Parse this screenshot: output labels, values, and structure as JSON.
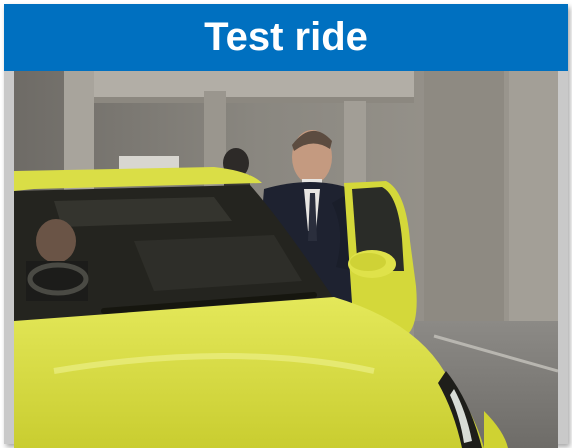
{
  "slide": {
    "title": "Test ride",
    "title_bar_color": "#0070c0",
    "frame_color": "#c9c9c9"
  },
  "photo": {
    "subject": "person-leaning-into-yellow-car",
    "car_color": "#d8dc3a",
    "background_color": "#7a7670"
  }
}
